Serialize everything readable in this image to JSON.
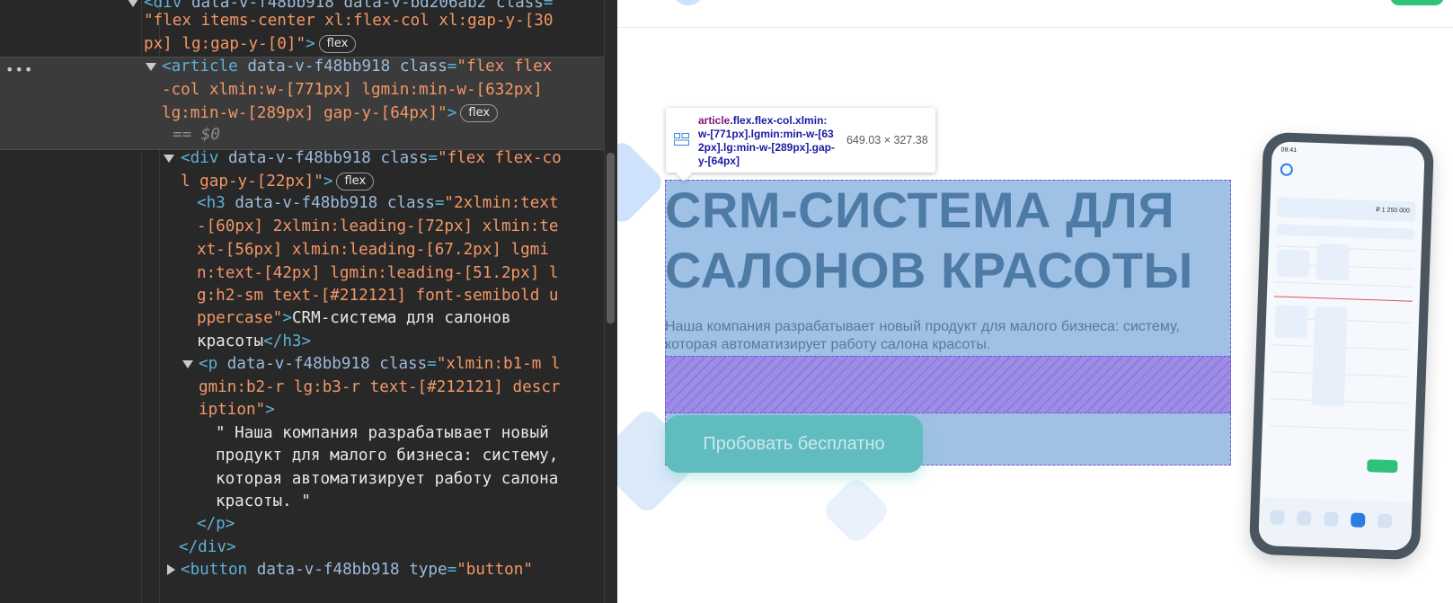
{
  "devtools": {
    "lines": [
      {
        "kind": "open",
        "parts": [
          [
            "tag",
            "<div "
          ],
          [
            "attr",
            "data-v-f48bb918 data-v-bd206ab2 class"
          ],
          [
            "tag",
            "="
          ]
        ]
      },
      {
        "kind": "cont",
        "parts": [
          [
            "val",
            "\"flex items-center xl:flex-col xl:gap-y-[30"
          ]
        ]
      },
      {
        "kind": "cont",
        "parts": [
          [
            "val",
            "px] lg:gap-y-[0]\""
          ],
          [
            "tag",
            ">"
          ]
        ],
        "badge": "flex"
      },
      {
        "kind": "sel",
        "parts": [
          [
            "tag",
            "<article "
          ],
          [
            "attr",
            "data-v-f48bb918 "
          ],
          [
            "attr",
            "class"
          ],
          [
            "tag",
            "="
          ],
          [
            "val",
            "\"flex flex"
          ]
        ]
      },
      {
        "kind": "cont",
        "parts": [
          [
            "val",
            "-col xlmin:w-[771px] lgmin:min-w-[632px]"
          ]
        ]
      },
      {
        "kind": "cont",
        "parts": [
          [
            "val",
            "lg:min-w-[289px] gap-y-[64px]\""
          ],
          [
            "tag",
            ">"
          ]
        ],
        "badge": "flex"
      },
      {
        "kind": "cont",
        "parts": [
          [
            "dim",
            "== $0"
          ]
        ]
      },
      {
        "kind": "open",
        "parts": [
          [
            "tag",
            "<div "
          ],
          [
            "attr",
            "data-v-f48bb918 "
          ],
          [
            "attr",
            "class"
          ],
          [
            "tag",
            "="
          ],
          [
            "val",
            "\"flex flex-co"
          ]
        ]
      },
      {
        "kind": "cont",
        "parts": [
          [
            "val",
            "l gap-y-[22px]\""
          ],
          [
            "tag",
            ">"
          ]
        ],
        "badge": "flex"
      },
      {
        "kind": "cont",
        "parts": [
          [
            "tag",
            "<h3 "
          ],
          [
            "attr",
            "data-v-f48bb918 "
          ],
          [
            "attr",
            "class"
          ],
          [
            "tag",
            "="
          ],
          [
            "val",
            "\"2xlmin:text"
          ]
        ]
      },
      {
        "kind": "cont",
        "parts": [
          [
            "val",
            "-[60px] 2xlmin:leading-[72px] xlmin:te"
          ]
        ]
      },
      {
        "kind": "cont",
        "parts": [
          [
            "val",
            "xt-[56px] xlmin:leading-[67.2px] lgmi"
          ]
        ]
      },
      {
        "kind": "cont",
        "parts": [
          [
            "val",
            "n:text-[42px] lgmin:leading-[51.2px] l"
          ]
        ]
      },
      {
        "kind": "cont",
        "parts": [
          [
            "val",
            "g:h2-sm text-[#212121] font-semibold u"
          ]
        ]
      },
      {
        "kind": "cont",
        "parts": [
          [
            "val",
            "ppercase\""
          ],
          [
            "tag",
            ">"
          ],
          [
            "txt",
            "CRM-система для салонов"
          ]
        ]
      },
      {
        "kind": "cont",
        "parts": [
          [
            "txt",
            "красоты"
          ],
          [
            "tag",
            "</h3>"
          ]
        ]
      },
      {
        "kind": "open",
        "parts": [
          [
            "tag",
            "<p "
          ],
          [
            "attr",
            "data-v-f48bb918 "
          ],
          [
            "attr",
            "class"
          ],
          [
            "tag",
            "="
          ],
          [
            "val",
            "\"xlmin:b1-m l"
          ]
        ]
      },
      {
        "kind": "cont",
        "parts": [
          [
            "val",
            "gmin:b2-r lg:b3-r text-[#212121] descr"
          ]
        ]
      },
      {
        "kind": "cont",
        "parts": [
          [
            "val",
            "iption\""
          ],
          [
            "tag",
            ">"
          ]
        ]
      },
      {
        "kind": "cont",
        "parts": [
          [
            "txt",
            "\" Наша компания разрабатывает новый"
          ]
        ]
      },
      {
        "kind": "cont",
        "parts": [
          [
            "txt",
            "продукт для малого бизнеса: систему,"
          ]
        ]
      },
      {
        "kind": "cont",
        "parts": [
          [
            "txt",
            "которая автоматизирует работу салона"
          ]
        ]
      },
      {
        "kind": "cont",
        "parts": [
          [
            "txt",
            "красоты. \""
          ]
        ]
      },
      {
        "kind": "cont",
        "parts": [
          [
            "tag",
            "</p>"
          ]
        ]
      },
      {
        "kind": "cont",
        "parts": [
          [
            "tag",
            "</div>"
          ]
        ]
      },
      {
        "kind": "closed",
        "parts": [
          [
            "tag",
            "<button "
          ],
          [
            "attr",
            "data-v-f48bb918 "
          ],
          [
            "attr",
            "type"
          ],
          [
            "tag",
            "="
          ],
          [
            "val",
            "\"button\""
          ]
        ]
      }
    ],
    "dots_label": "•••"
  },
  "page": {
    "tooltip": {
      "tag_name": "article",
      "selector_rest": ".flex.flex-col.xlmin:w-[771px].lgmin:min-w-[632px].lg:min-w-[289px].gap-y-[64px]",
      "size": "649.03 × 327.38"
    },
    "hero_title": "CRM-система для салонов красоты",
    "hero_description": "Наша компания разрабатывает новый продукт для малого бизнеса: систему, которая автоматизирует работу салона красоты.",
    "cta_label": "Пробовать бесплатно",
    "phone": {
      "time": "09:41",
      "amount": "₽ 1 250 000"
    }
  },
  "colors": {
    "highlight_content": "#9fc1e6",
    "highlight_gap": "#9d8de6",
    "cta": "#61bcc0",
    "title": "#4e7ba6"
  }
}
